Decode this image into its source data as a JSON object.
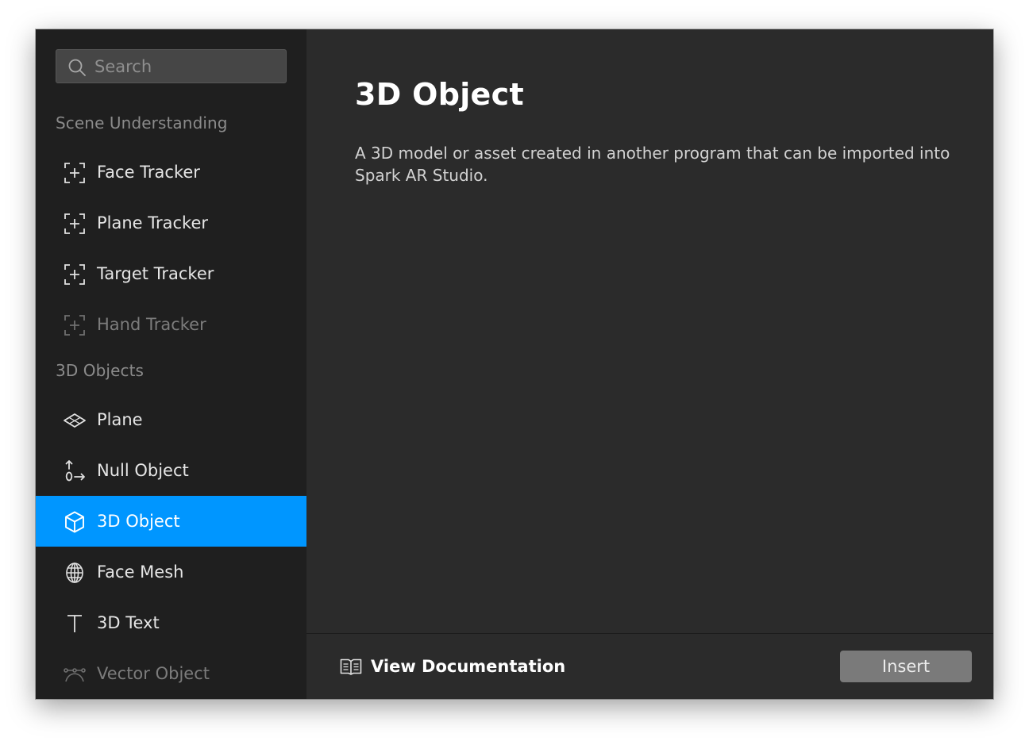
{
  "search": {
    "placeholder": "Search",
    "value": ""
  },
  "sidebar": {
    "sections": [
      {
        "label": "Scene Understanding",
        "items": [
          {
            "label": "Face Tracker",
            "icon": "tracker-icon",
            "disabled": false
          },
          {
            "label": "Plane Tracker",
            "icon": "tracker-icon",
            "disabled": false
          },
          {
            "label": "Target Tracker",
            "icon": "tracker-icon",
            "disabled": false
          },
          {
            "label": "Hand Tracker",
            "icon": "tracker-icon",
            "disabled": true
          }
        ]
      },
      {
        "label": "3D Objects",
        "items": [
          {
            "label": "Plane",
            "icon": "plane-icon",
            "disabled": false
          },
          {
            "label": "Null Object",
            "icon": "null-object-icon",
            "disabled": false
          },
          {
            "label": "3D Object",
            "icon": "cube-icon",
            "disabled": false,
            "selected": true
          },
          {
            "label": "Face Mesh",
            "icon": "globe-mesh-icon",
            "disabled": false
          },
          {
            "label": "3D Text",
            "icon": "text-icon",
            "disabled": false
          },
          {
            "label": "Vector Object",
            "icon": "vector-icon",
            "disabled": true
          }
        ]
      }
    ]
  },
  "detail": {
    "title": "3D Object",
    "description": "A 3D model or asset created in another program that can be imported into Spark AR Studio."
  },
  "footer": {
    "doc_link_label": "View Documentation",
    "doc_icon": "book-icon",
    "insert_label": "Insert"
  },
  "colors": {
    "selected": "#0096ff",
    "sidebar_bg": "#1f1f1f",
    "main_bg": "#2b2b2b",
    "button_bg": "#7a7a7a"
  }
}
